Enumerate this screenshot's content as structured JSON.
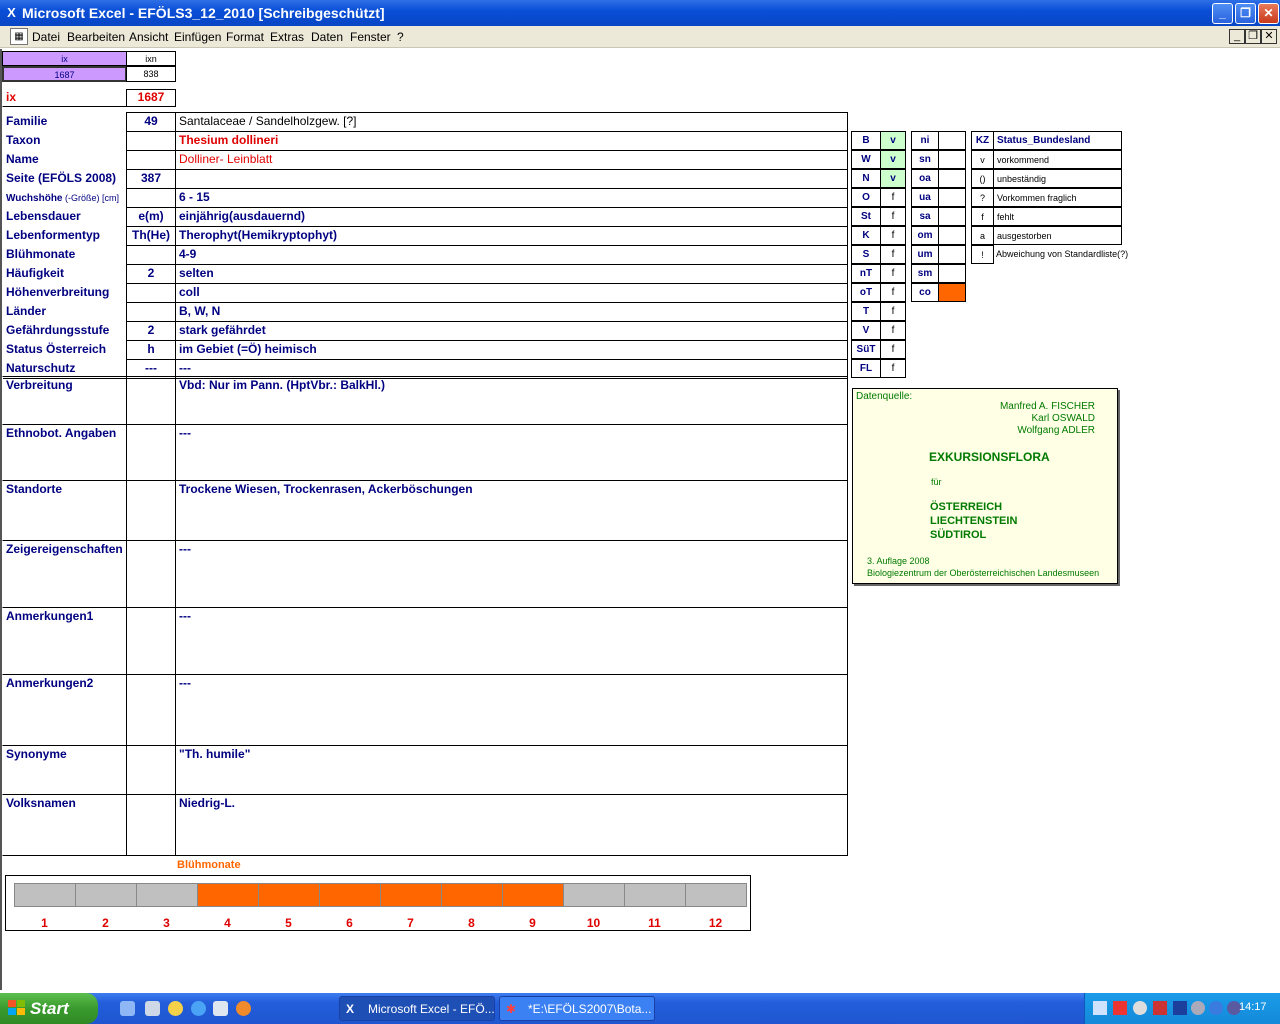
{
  "window": {
    "title": "Microsoft Excel - EFÖLS3_12_2010  [Schreibgeschützt]",
    "app_icon": "excel-icon"
  },
  "menu": [
    "Datei",
    "Bearbeiten",
    "Ansicht",
    "Einfügen",
    "Format",
    "Extras",
    "Daten",
    "Fenster",
    "?"
  ],
  "index": {
    "hdr_ix": "ix",
    "hdr_ixn": "ixn",
    "val_ix": "1687",
    "val_ixn": "838",
    "label": "ix",
    "value": "1687"
  },
  "rows": [
    {
      "label": "Familie",
      "code": "49",
      "value": "Santalaceae  /  Sandelholzgew. [?]"
    },
    {
      "label": "Taxon",
      "code": "",
      "value": "Thesium dollineri"
    },
    {
      "label": "Name",
      "code": "",
      "value": "Dolliner- Leinblatt"
    },
    {
      "label": "Seite (EFÖLS 2008)",
      "code": "387",
      "value": ""
    },
    {
      "label_bold": "Wuchshöhe",
      "label_small": " (-Größe) [cm]",
      "code": "",
      "value": " 6 - 15"
    },
    {
      "label": "Lebensdauer",
      "code": "e(m)",
      "value": "einjährig(ausdauernd)"
    },
    {
      "label": "Lebenformentyp",
      "code": "Th(He)",
      "value": "Therophyt(Hemikryptophyt)"
    },
    {
      "label": "Blühmonate",
      "code": "",
      "value": " 4-9"
    },
    {
      "label": "Häufigkeit",
      "code": "2",
      "value": "selten"
    },
    {
      "label": "Höhenverbreitung",
      "code": "",
      "value": "coll"
    },
    {
      "label": "Länder",
      "code": "",
      "value": "B, W, N"
    },
    {
      "label": "Gefährdungsstufe",
      "code": "2",
      "value": "stark gefährdet"
    },
    {
      "label": "Status Österreich",
      "code": "h",
      "value": "im Gebiet (=Ö) heimisch"
    },
    {
      "label": "Naturschutz",
      "code": "---",
      "value": " ---"
    }
  ],
  "bigrows": [
    {
      "label": "Verbreitung",
      "value": "Vbd: Nur im Pann. (HptVbr.: BalkHl.)"
    },
    {
      "label": "Ethnobot. Angaben",
      "value": "---"
    },
    {
      "label": "Standorte",
      "value": "Trockene Wiesen, Trockenrasen, Ackerböschungen"
    },
    {
      "label": "Zeigereigenschaften",
      "value": "---"
    },
    {
      "label": "Anmerkungen1",
      "value": "---"
    },
    {
      "label": "Anmerkungen2",
      "value": "---"
    },
    {
      "label": "Synonyme",
      "value": "\"Th. humile\""
    },
    {
      "label": "Volksnamen",
      "value": "Niedrig-L."
    }
  ],
  "states": [
    {
      "code": "B",
      "val": "v"
    },
    {
      "code": "W",
      "val": "v"
    },
    {
      "code": "N",
      "val": "v"
    },
    {
      "code": "O",
      "val": "f"
    },
    {
      "code": "St",
      "val": "f"
    },
    {
      "code": "K",
      "val": "f"
    },
    {
      "code": "S",
      "val": "f"
    },
    {
      "code": "nT",
      "val": "f"
    },
    {
      "code": "oT",
      "val": "f"
    },
    {
      "code": "T",
      "val": "f"
    },
    {
      "code": "V",
      "val": "f"
    },
    {
      "code": "SüT",
      "val": "f"
    },
    {
      "code": "FL",
      "val": "f"
    }
  ],
  "regions": [
    "ni",
    "sn",
    "oa",
    "ua",
    "sa",
    "om",
    "um",
    "sm",
    "co"
  ],
  "legend_header": {
    "kz": "KZ",
    "title": "Status_Bundesland"
  },
  "legend": [
    {
      "kz": "v",
      "text": "vorkommend"
    },
    {
      "kz": "()",
      "text": "unbeständig"
    },
    {
      "kz": "?",
      "text": "Vorkommen fraglich"
    },
    {
      "kz": "f",
      "text": "fehlt"
    },
    {
      "kz": "a",
      "text": "ausgestorben"
    },
    {
      "kz": "!",
      "text": "Abweichung von Standardliste(?)"
    }
  ],
  "source": {
    "label": "Datenquelle:",
    "authors": [
      "Manfred A. FISCHER",
      "Karl OSWALD",
      "Wolfgang ADLER"
    ],
    "title": "EXKURSIONSFLORA",
    "fuer": "für",
    "countries": [
      "ÖSTERREICH",
      "LIECHTENSTEIN",
      "SÜDTIROL"
    ],
    "edition": "3. Auflage 2008",
    "publisher": "Biologiezentrum der Oberösterreichischen Landesmuseen"
  },
  "chart_data": {
    "type": "bar",
    "title": "Blühmonate",
    "categories": [
      "1",
      "2",
      "3",
      "4",
      "5",
      "6",
      "7",
      "8",
      "9",
      "10",
      "11",
      "12"
    ],
    "values": [
      0,
      0,
      0,
      1,
      1,
      1,
      1,
      1,
      1,
      0,
      0,
      0
    ],
    "colors": {
      "active": "#ff6600",
      "inactive": "#c0c0c0"
    }
  },
  "taskbar": {
    "start": "Start",
    "tasks": [
      {
        "label": "Microsoft Excel - EFÖ...",
        "icon": "excel-icon"
      },
      {
        "label": "*E:\\EFÖLS2007\\Bota...",
        "icon": "paint-icon"
      }
    ],
    "clock": "14:17"
  },
  "colors": {
    "accent_orange": "#ff6600",
    "index_purple": "#cc99ff",
    "green_state": "#ccffcc",
    "title_red": "#e00000",
    "label_navy": "#000080"
  }
}
